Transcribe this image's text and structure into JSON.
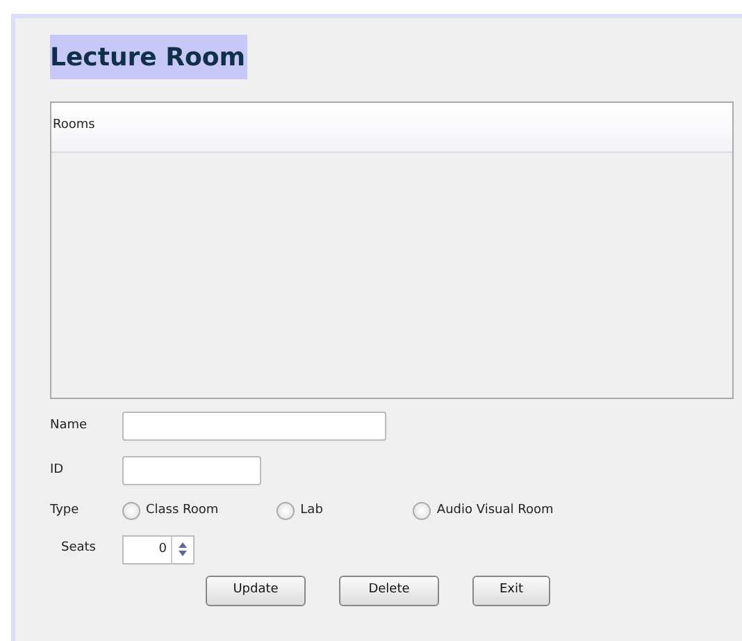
{
  "title": "Lecture Room",
  "table": {
    "columns": [
      "Rooms"
    ]
  },
  "fields": [
    {
      "label": "Name"
    },
    {
      "label": "ID"
    }
  ],
  "type": {
    "label": "Type",
    "options": [
      {
        "label": "Class Room",
        "selected": false
      },
      {
        "label": "Lab",
        "selected": false
      },
      {
        "label": "Audio Visual Room",
        "selected": false
      }
    ]
  },
  "seats": {
    "label": "Seats",
    "value": "0"
  },
  "buttons": [
    "Update",
    "Delete",
    "Exit"
  ]
}
